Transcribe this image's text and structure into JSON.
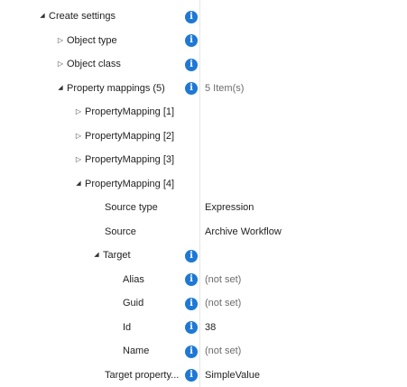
{
  "tree": {
    "create_settings": {
      "label": "Create settings",
      "info": "i"
    },
    "object_type": {
      "label": "Object type",
      "info": "i"
    },
    "object_class": {
      "label": "Object class",
      "info": "i"
    },
    "property_mappings": {
      "label": "Property mappings (5)",
      "info": "i",
      "value": "5 Item(s)"
    },
    "mapping_1": {
      "label": "PropertyMapping [1]"
    },
    "mapping_2": {
      "label": "PropertyMapping [2]"
    },
    "mapping_3": {
      "label": "PropertyMapping [3]"
    },
    "mapping_4": {
      "label": "PropertyMapping [4]"
    },
    "source_type": {
      "label": "Source type",
      "value": "Expression"
    },
    "source": {
      "label": "Source",
      "value": "Archive Workflow"
    },
    "target": {
      "label": "Target",
      "info": "i"
    },
    "alias": {
      "label": "Alias",
      "info": "i",
      "value": "(not set)"
    },
    "guid": {
      "label": "Guid",
      "info": "i",
      "value": "(not set)"
    },
    "id": {
      "label": "Id",
      "info": "i",
      "value": "38"
    },
    "name": {
      "label": "Name",
      "info": "i",
      "value": "(not set)"
    },
    "target_property": {
      "label": "Target property...",
      "info": "i",
      "value": "SimpleValue"
    }
  },
  "glyphs": {
    "expanded": "◢",
    "collapsed": "▷"
  },
  "colors": {
    "info_icon": "#1e78d4",
    "muted_text": "#6b6b6b",
    "divider": "#e6e6e6"
  }
}
